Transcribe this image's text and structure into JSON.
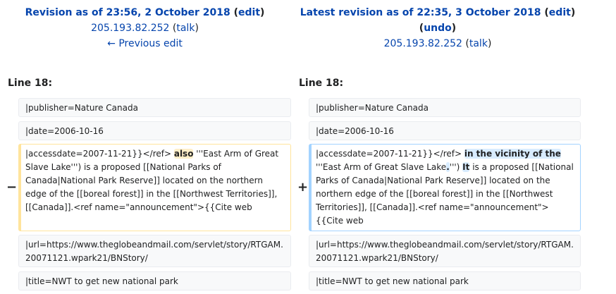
{
  "left_header": {
    "title_prefix": "Revision as of 23:56, 2 October 2018",
    "edit_label": "edit",
    "user": "205.193.82.252",
    "talk_label": "talk",
    "prev_link": "← Previous edit"
  },
  "right_header": {
    "title_prefix": "Latest revision as of 22:35, 3 October 2018",
    "edit_label": "edit",
    "undo_label": "undo",
    "user": "205.193.82.252",
    "talk_label": "talk"
  },
  "line_label_left": "Line 18:",
  "line_label_right": "Line 18:",
  "markers": {
    "minus": "−",
    "plus": "+"
  },
  "rows": {
    "publisher": "|publisher=Nature Canada",
    "date": "|date=2006-10-16",
    "url": "|url=https://www.theglobeandmail.com/servlet/story/RTGAM.20071121.wpark21/BNStory/",
    "title": "|title=NWT to get new national park"
  },
  "deleted": {
    "part1": "|accessdate=2007-11-21}}</ref> ",
    "highlight": "also",
    "part2": " '''East Arm of Great Slave Lake''') is a proposed [[National Parks of Canada|National Park Reserve]] located on the northern edge of the [[boreal forest]] in the [[Northwest Territories]], [[Canada]].<ref name=\"announcement\">{{Cite web"
  },
  "added": {
    "part1": "|accessdate=2007-11-21}}</ref> ",
    "highlight1": "in the vicinity of the",
    "part2": " '''East Arm of Great Slave Lake",
    "highlight2": ".",
    "part3": "''') ",
    "highlight3": "It",
    "part4": " is a proposed [[National Parks of Canada|National Park Reserve]] located on the northern edge of the [[boreal forest]] in the [[Northwest Territories]], [[Canada]].<ref name=\"announcement\">{{Cite web"
  }
}
